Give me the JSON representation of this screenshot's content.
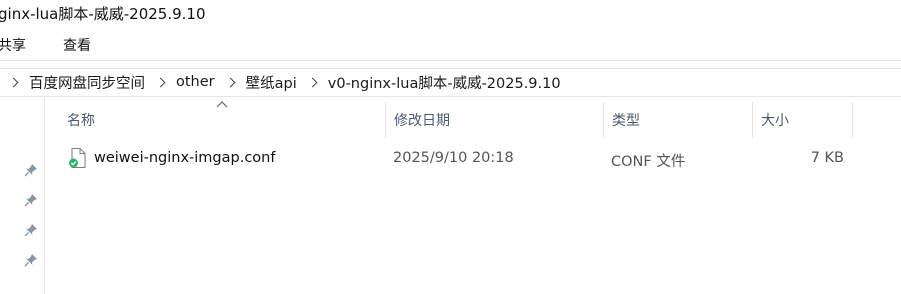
{
  "window": {
    "title": "ginx-lua脚本-威威-2025.9.10"
  },
  "ribbon": {
    "tabs": [
      "共享",
      "查看"
    ]
  },
  "breadcrumb": [
    "百度网盘同步空间",
    "other",
    "壁纸api",
    "v0-nginx-lua脚本-威威-2025.9.10"
  ],
  "columns": {
    "name": "名称",
    "date": "修改日期",
    "type": "类型",
    "size": "大小"
  },
  "files": [
    {
      "name": "weiwei-nginx-imgap.conf",
      "date": "2025/9/10 20:18",
      "type": "CONF 文件",
      "size": "7 KB",
      "icon": "conf-file-icon",
      "sync_status": "synced"
    }
  ],
  "colors": {
    "sync_badge": "#2fb36b",
    "header_text": "#4d5a6e"
  }
}
